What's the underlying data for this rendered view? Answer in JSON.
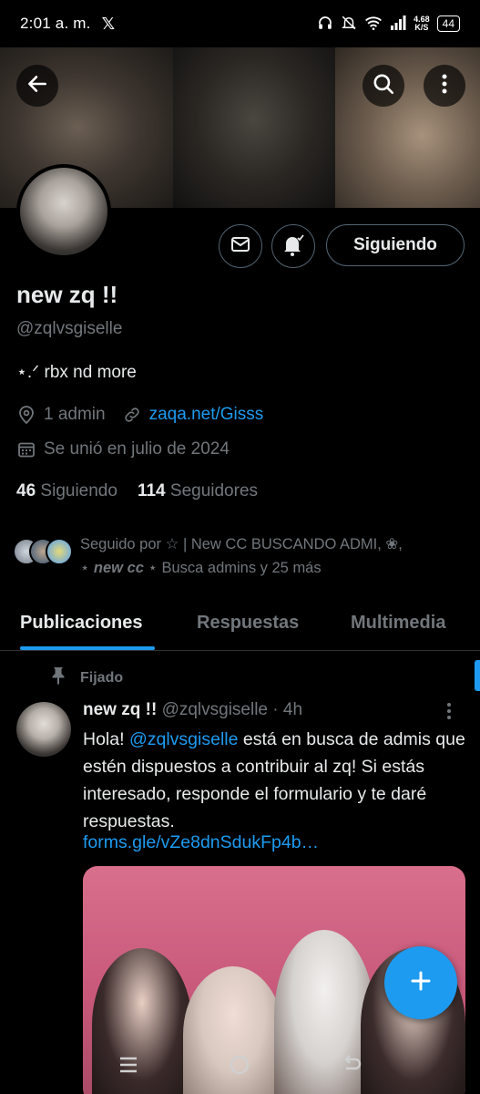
{
  "status_bar": {
    "time": "2:01 a. m.",
    "app_icon": "x-logo",
    "net_speed_value": "4.68",
    "net_speed_unit": "K/S",
    "battery": "44"
  },
  "banner": {
    "back_icon": "arrow-left-icon",
    "search_icon": "search-icon",
    "more_icon": "more-vertical-icon"
  },
  "profile": {
    "name": "new zq !!",
    "handle": "@zqlvsgiselle",
    "bio": "⋆.ᐟ rbx nd more",
    "location": "1 admin",
    "website": "zaqa.net/Gisss",
    "joined": "Se unió en julio de 2024",
    "following_count": "46",
    "following_label": "Siguiendo",
    "followers_count": "114",
    "followers_label": "Seguidores",
    "follow_button": "Siguiendo",
    "followed_by_line1": "Seguido por ☆ | New CC BUSCANDO ADMI, ❀,",
    "followed_by_line2_pre": "⋆ ",
    "followed_by_line2_name": "new cc",
    "followed_by_line2_post": " ⋆ Busca admins y 25 más"
  },
  "tabs": [
    {
      "label": "Publicaciones",
      "active": true
    },
    {
      "label": "Respuestas",
      "active": false
    },
    {
      "label": "Multimedia",
      "active": false
    }
  ],
  "tweet": {
    "pinned_label": "Fijado",
    "author_name": "new zq !!",
    "author_handle": "@zqlvsgiselle",
    "time": "· 4h",
    "text_pre": "Hola! ",
    "mention": "@zqlvsgiselle",
    "text_post": " está en busca de admis que estén dispuestos a contribuir al zq! Si estás interesado, responde el formulario y te daré respuestas.",
    "link": "forms.gle/vZe8dnSdukFp4b…"
  },
  "colors": {
    "accent": "#1d9bf0",
    "muted": "#71767b",
    "text": "#e7e9ea",
    "border": "#536471",
    "background": "#000000"
  },
  "fab": {
    "icon": "plus-icon"
  },
  "navbar": {
    "menu_icon": "recent-apps-icon",
    "home_icon": "home-circle-icon",
    "back_icon": "nav-back-icon"
  }
}
